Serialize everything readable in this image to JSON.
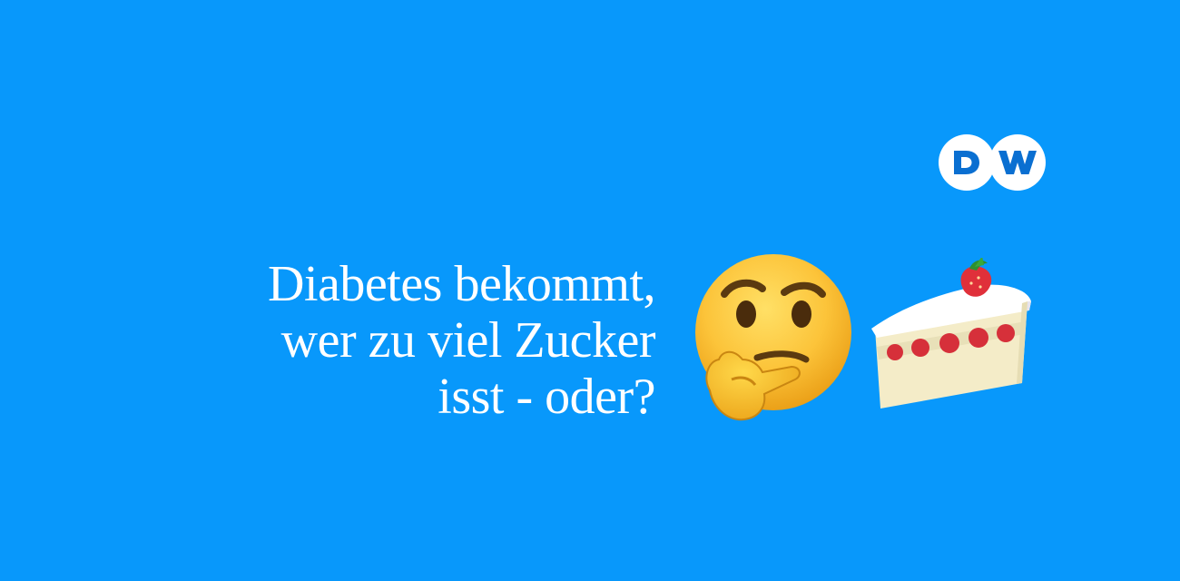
{
  "brand": {
    "logo_text": "DW",
    "background_color": "#0898fb"
  },
  "headline": {
    "line1": "Diabetes bekommt,",
    "line2": "wer zu viel Zucker",
    "line3": "isst - oder?"
  },
  "icons": {
    "thinking": "thinking-face-icon",
    "cake": "strawberry-shortcake-icon"
  }
}
